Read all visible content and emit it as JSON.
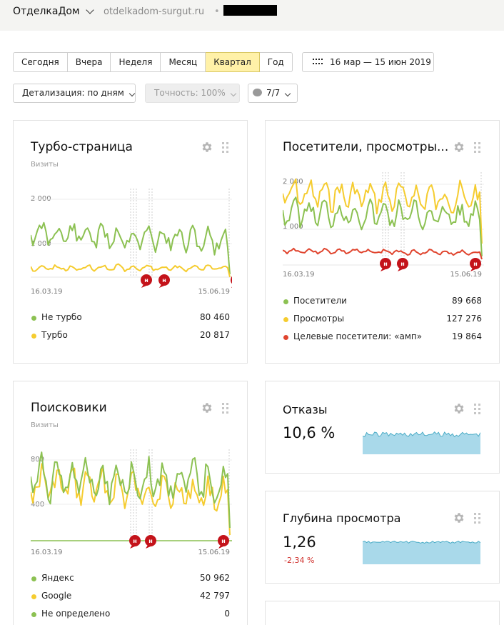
{
  "header": {
    "site_name": "ОтделкаДом",
    "domain": "otdelkadom-surgut.ru",
    "separator": "•"
  },
  "toolbar": {
    "periods": [
      {
        "label": "Сегодня",
        "active": false
      },
      {
        "label": "Вчера",
        "active": false
      },
      {
        "label": "Неделя",
        "active": false
      },
      {
        "label": "Месяц",
        "active": false
      },
      {
        "label": "Квартал",
        "active": true
      },
      {
        "label": "Год",
        "active": false
      }
    ],
    "date_range": "16 мар — 15 июн 2019",
    "detail_select": "Детализация: по дням",
    "accuracy_select": "Точность: 100%",
    "notes_select": "7/7"
  },
  "annotation_marker": "н",
  "colors": {
    "green": "#8cc152",
    "yellow": "#f5cc2f",
    "red": "#e0452f",
    "marker": "#c4131a",
    "area_fill": "#a9d9ea",
    "area_line": "#4bacc6",
    "delta_negative": "#d0312d"
  },
  "cards": {
    "turbo": {
      "title": "Турбо-страница",
      "subtitle": "Визиты",
      "y_ticks": [
        "2 000",
        "1 000"
      ],
      "x_start": "16.03.19",
      "x_end": "15.06.19",
      "legend": [
        {
          "name": "Не турбо",
          "value": "80 460",
          "color": "#8cc152"
        },
        {
          "name": "Турбо",
          "value": "20 817",
          "color": "#f5cc2f"
        }
      ]
    },
    "visitors": {
      "title": "Посетители, просмотры...",
      "y_ticks": [
        "2 000",
        "1 000"
      ],
      "x_start": "16.03.19",
      "x_end": "15.06.19",
      "legend": [
        {
          "name": "Посетители",
          "value": "89 668",
          "color": "#8cc152"
        },
        {
          "name": "Просмотры",
          "value": "127 276",
          "color": "#f5cc2f"
        },
        {
          "name": "Целевые посетители: «амп»",
          "value": "19 864",
          "color": "#e0452f"
        }
      ]
    },
    "search": {
      "title": "Поисковики",
      "subtitle": "Визиты",
      "y_ticks": [
        "800",
        "400"
      ],
      "x_start": "16.03.19",
      "x_end": "15.06.19",
      "legend": [
        {
          "name": "Яндекс",
          "value": "50 962",
          "color": "#8cc152"
        },
        {
          "name": "Google",
          "value": "42 797",
          "color": "#f5cc2f"
        },
        {
          "name": "Не определено",
          "value": "0",
          "color": "#8cc152"
        }
      ]
    },
    "bounce": {
      "title": "Отказы",
      "value": "10,6 %"
    },
    "depth": {
      "title": "Глубина просмотра",
      "value": "1,26",
      "delta": "-2,34 %"
    }
  }
}
